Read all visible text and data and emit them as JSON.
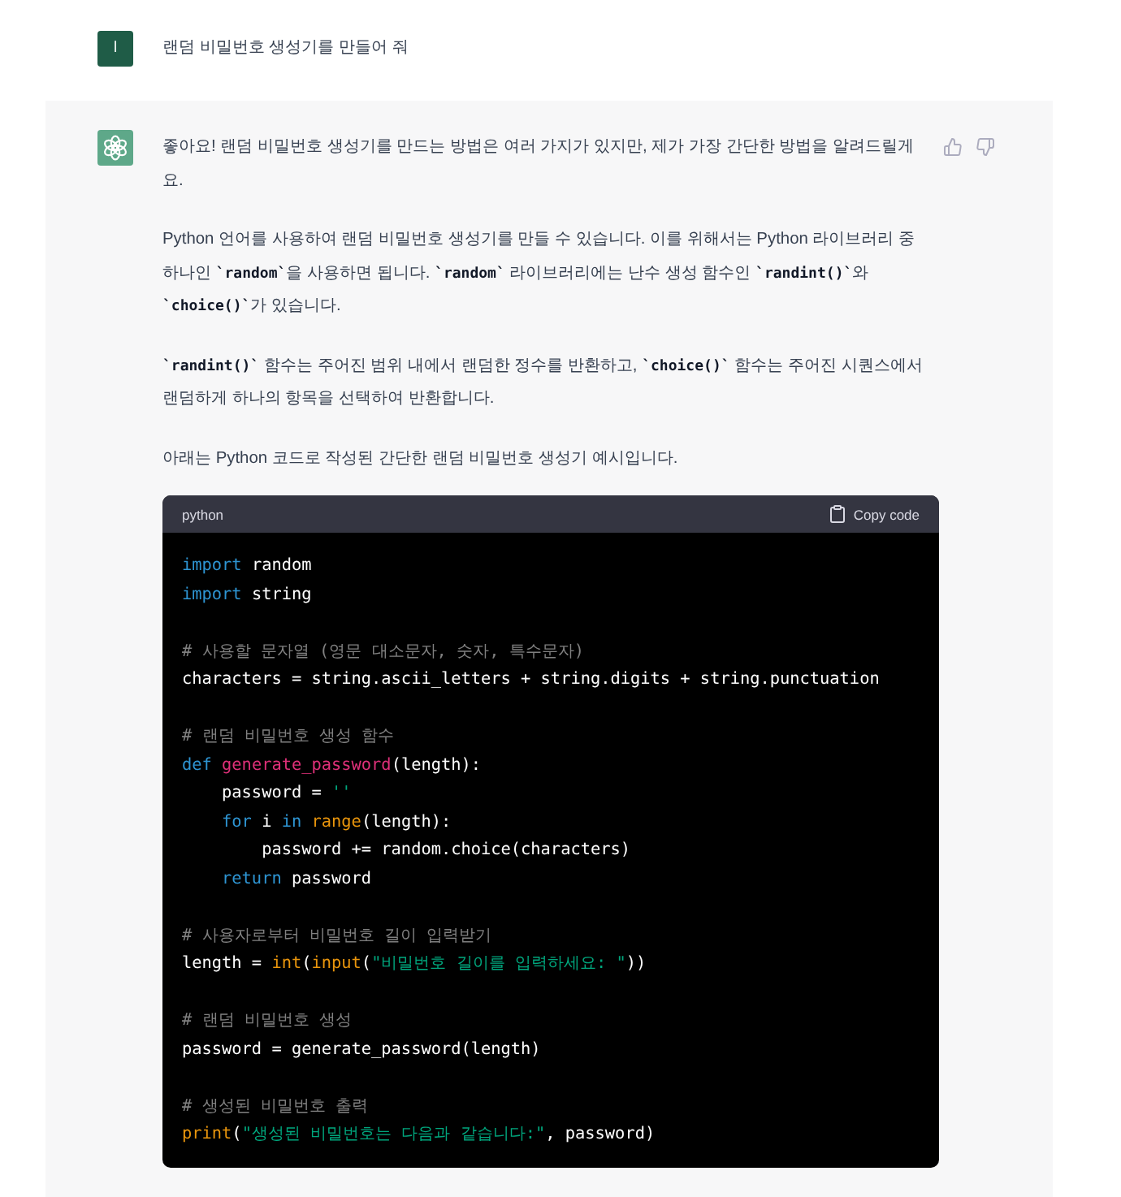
{
  "user_message": {
    "avatar_initial": "I",
    "text": "랜덤 비밀번호 생성기를 만들어 줘"
  },
  "assistant_message": {
    "paragraphs": [
      [
        {
          "kind": "text",
          "text": "좋아요! 랜덤 비밀번호 생성기를 만드는 방법은 여러 가지가 있지만, 제가 가장 간단한 방법을 알려드릴게요."
        }
      ],
      [
        {
          "kind": "text",
          "text": "Python 언어를 사용하여 랜덤 비밀번호 생성기를 만들 수 있습니다. 이를 위해서는 Python 라이브러리 중 하나인 "
        },
        {
          "kind": "code",
          "text": "`random`"
        },
        {
          "kind": "text",
          "text": "을 사용하면 됩니다. "
        },
        {
          "kind": "code",
          "text": "`random`"
        },
        {
          "kind": "text",
          "text": " 라이브러리에는 난수 생성 함수인 "
        },
        {
          "kind": "code",
          "text": "`randint()`"
        },
        {
          "kind": "text",
          "text": "와 "
        },
        {
          "kind": "code",
          "text": "`choice()`"
        },
        {
          "kind": "text",
          "text": "가 있습니다."
        }
      ],
      [
        {
          "kind": "code",
          "text": "`randint()`"
        },
        {
          "kind": "text",
          "text": " 함수는 주어진 범위 내에서 랜덤한 정수를 반환하고, "
        },
        {
          "kind": "code",
          "text": "`choice()`"
        },
        {
          "kind": "text",
          "text": " 함수는 주어진 시퀀스에서 랜덤하게 하나의 항목을 선택하여 반환합니다."
        }
      ],
      [
        {
          "kind": "text",
          "text": "아래는 Python 코드로 작성된 간단한 랜덤 비밀번호 생성기 예시입니다."
        }
      ]
    ],
    "code_block": {
      "language": "python",
      "copy_label": "Copy code",
      "blocks": [
        [
          [
            {
              "kind": "keyword",
              "text": "import"
            },
            {
              "kind": "plain",
              "text": " random"
            }
          ],
          [
            {
              "kind": "keyword",
              "text": "import"
            },
            {
              "kind": "plain",
              "text": " string"
            }
          ]
        ],
        [
          [
            {
              "kind": "comment",
              "text": "# 사용할 문자열 (영문 대소문자, 숫자, 특수문자)"
            }
          ],
          [
            {
              "kind": "plain",
              "text": "characters = string.ascii_letters + string.digits + string.punctuation"
            }
          ]
        ],
        [
          [
            {
              "kind": "comment",
              "text": "# 랜덤 비밀번호 생성 함수"
            }
          ],
          [
            {
              "kind": "keyword",
              "text": "def"
            },
            {
              "kind": "function",
              "text": " generate_password"
            },
            {
              "kind": "plain",
              "text": "(length):"
            }
          ],
          [
            {
              "kind": "plain",
              "text": "    password = "
            },
            {
              "kind": "string",
              "text": "''"
            }
          ],
          [
            {
              "kind": "keyword",
              "text": "    for"
            },
            {
              "kind": "plain",
              "text": " i "
            },
            {
              "kind": "keyword",
              "text": "in"
            },
            {
              "kind": "builtin",
              "text": " range"
            },
            {
              "kind": "plain",
              "text": "(length):"
            }
          ],
          [
            {
              "kind": "plain",
              "text": "        password += random.choice(characters)"
            }
          ],
          [
            {
              "kind": "keyword",
              "text": "    return"
            },
            {
              "kind": "plain",
              "text": " password"
            }
          ]
        ],
        [
          [
            {
              "kind": "comment",
              "text": "# 사용자로부터 비밀번호 길이 입력받기"
            }
          ],
          [
            {
              "kind": "plain",
              "text": "length = "
            },
            {
              "kind": "builtin",
              "text": "int"
            },
            {
              "kind": "plain",
              "text": "("
            },
            {
              "kind": "builtin",
              "text": "input"
            },
            {
              "kind": "plain",
              "text": "("
            },
            {
              "kind": "string",
              "text": "\"비밀번호 길이를 입력하세요: \""
            },
            {
              "kind": "plain",
              "text": "))"
            }
          ]
        ],
        [
          [
            {
              "kind": "comment",
              "text": "# 랜덤 비밀번호 생성"
            }
          ],
          [
            {
              "kind": "plain",
              "text": "password = generate_password(length)"
            }
          ]
        ],
        [
          [
            {
              "kind": "comment",
              "text": "# 생성된 비밀번호 출력"
            }
          ],
          [
            {
              "kind": "builtin",
              "text": "print"
            },
            {
              "kind": "plain",
              "text": "("
            },
            {
              "kind": "string",
              "text": "\"생성된 비밀번호는 다음과 같습니다:\""
            },
            {
              "kind": "plain",
              "text": ", password)"
            }
          ]
        ]
      ]
    }
  }
}
